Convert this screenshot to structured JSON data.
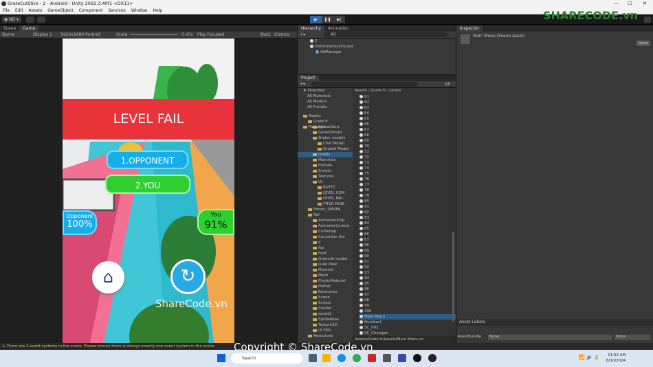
{
  "window": {
    "title": "GrateCutSlice - 2 - Android - Unity 2022.3.40f1 <DX11>"
  },
  "menu": [
    "File",
    "Edit",
    "Assets",
    "GameObject",
    "Component",
    "Services",
    "Window",
    "Help"
  ],
  "toolbar": {
    "account": "ND"
  },
  "scene_tabs": {
    "scene": "Scene",
    "game": "Game"
  },
  "game_bar": {
    "mode": "Game",
    "display": "Display 1",
    "resolution": "1920x1080 Portrait",
    "scale_label": "Scale",
    "scale_value": "0.47x",
    "play": "Play Focused",
    "stats": "Stats",
    "gizmos": "Gizmos"
  },
  "game_view": {
    "banner": "LEVEL FAIL",
    "btn1": "1.OPPONENT",
    "btn2": "2.YOU",
    "opp_label": "Opponent",
    "opp_value": "100%",
    "you_label": "You",
    "you_value": "91%",
    "watermark": "ShareCode.vn"
  },
  "hierarchy": {
    "tabs": [
      "Hierarchy",
      "Animation"
    ],
    "search": "All",
    "items": [
      "2",
      "DontDestroyOnLoad",
      "AdManager"
    ]
  },
  "project": {
    "tab": "Project",
    "count": "18",
    "favorites": {
      "label": "Favorites",
      "items": [
        "All Materials",
        "All Models",
        "All Prefabs"
      ]
    },
    "assets": {
      "label": "Assets",
      "items": [
        {
          "d": 1,
          "t": "Grate It"
        },
        {
          "d": 2,
          "t": "Animations"
        },
        {
          "d": 2,
          "t": "GameSetups"
        },
        {
          "d": 2,
          "t": "Grater models"
        },
        {
          "d": 3,
          "t": "Chef Model"
        },
        {
          "d": 3,
          "t": "GrateIt Model"
        },
        {
          "d": 2,
          "t": "Levels",
          "sel": true
        },
        {
          "d": 2,
          "t": "Materials"
        },
        {
          "d": 2,
          "t": "Prefabs"
        },
        {
          "d": 2,
          "t": "Scripts"
        },
        {
          "d": 2,
          "t": "Textures"
        },
        {
          "d": 2,
          "t": "UI"
        },
        {
          "d": 3,
          "t": "BUTTT"
        },
        {
          "d": 3,
          "t": "LEVEL COM"
        },
        {
          "d": 3,
          "t": "LEVEL FAIL"
        },
        {
          "d": 3,
          "t": "TITLE PAGE"
        },
        {
          "d": 1,
          "t": "Promo_SMXML"
        },
        {
          "d": 1,
          "t": "Ref"
        },
        {
          "d": 2,
          "t": "AnimationClip"
        },
        {
          "d": 2,
          "t": "AnimatorControl"
        },
        {
          "d": 2,
          "t": "Cubemap"
        },
        {
          "d": 2,
          "t": "Cucumber fbx"
        },
        {
          "d": 2,
          "t": "d"
        },
        {
          "d": 2,
          "t": "fbx"
        },
        {
          "d": 2,
          "t": "Font"
        },
        {
          "d": 2,
          "t": "Grenade model"
        },
        {
          "d": 2,
          "t": "Luke Peek"
        },
        {
          "d": 2,
          "t": "Material"
        },
        {
          "d": 2,
          "t": "Mesh"
        },
        {
          "d": 2,
          "t": "PhysicMaterial"
        },
        {
          "d": 2,
          "t": "Prefab"
        },
        {
          "d": 2,
          "t": "Resources"
        },
        {
          "d": 2,
          "t": "Scene"
        },
        {
          "d": 2,
          "t": "Scripts"
        },
        {
          "d": 2,
          "t": "Shader"
        },
        {
          "d": 2,
          "t": "sounds"
        },
        {
          "d": 2,
          "t": "SpriteAtlas"
        },
        {
          "d": 2,
          "t": "Texture2D"
        },
        {
          "d": 2,
          "t": "UI PNG"
        },
        {
          "d": 1,
          "t": "Resources"
        }
      ]
    },
    "packages": "Packages",
    "breadcrumb": [
      "Assets",
      "Grate It",
      "Levels"
    ],
    "files": [
      "61",
      "62",
      "63",
      "64",
      "65",
      "66",
      "67",
      "68",
      "69",
      "70",
      "71",
      "72",
      "73",
      "74",
      "75",
      "76",
      "77",
      "78",
      "79",
      "80",
      "81",
      "82",
      "83",
      "84",
      "85",
      "86",
      "87",
      "88",
      "89",
      "90",
      "91",
      "92",
      "93",
      "94",
      "95",
      "96",
      "97",
      "98",
      "99",
      "100",
      "Main Menu",
      "Number1",
      "SC_001",
      "SC_Changes"
    ],
    "selected_file": "Main Menu",
    "path": "Assets/Grate It/Levels/Main Menu.un"
  },
  "inspector": {
    "tab": "Inspector",
    "asset": "Main Menu (Scene Asset)",
    "open": "Open",
    "labels": "Asset Labels",
    "bundle_label": "AssetBundle",
    "bundle_value": "None",
    "variant": "None"
  },
  "status": "There are 2 event systems in the scene. Please ensure there is always exactly one event system in the scene",
  "taskbar": {
    "search": "Search",
    "time": "11:52 AM",
    "date": "8/10/2024"
  },
  "overlay": {
    "logo": "SHARECODE.vn",
    "copyright": "Copyright © ShareCode.vn"
  },
  "colors": {
    "banner": "#e8333b",
    "cyan": "#16aee8",
    "green": "#2fcf2f"
  }
}
